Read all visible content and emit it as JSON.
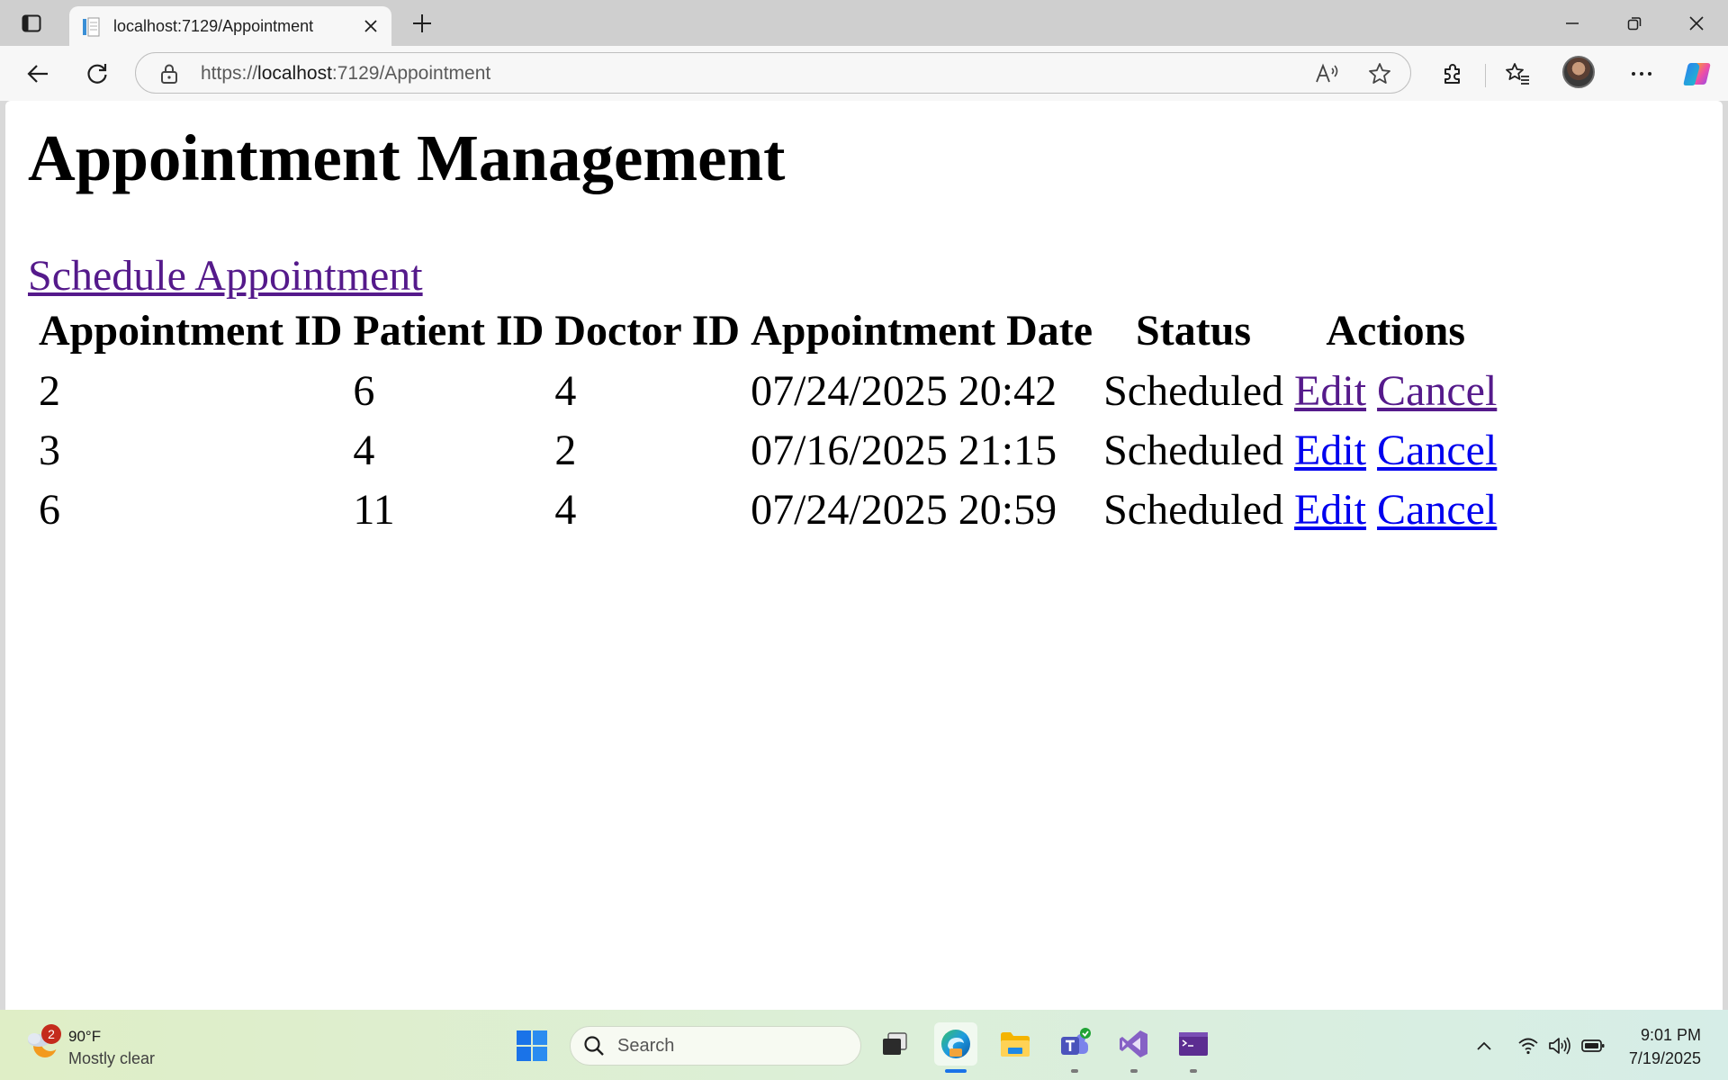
{
  "browser": {
    "tab": {
      "title": "localhost:7129/Appointment",
      "close_icon": "close-icon",
      "favicon": "page-icon"
    },
    "new_tab_icon": "plus-icon",
    "window_controls": [
      "minimize-icon",
      "restore-icon",
      "close-icon"
    ],
    "address": {
      "scheme": "https://",
      "host": "localhost",
      "rest": ":7129/Appointment"
    },
    "toolbar_icons": [
      "back-icon",
      "refresh-icon",
      "lock-icon",
      "read-aloud-icon",
      "favorite-star-icon",
      "extensions-icon",
      "favorites-icon",
      "profile-avatar",
      "more-icon",
      "copilot-icon"
    ]
  },
  "page": {
    "heading": "Appointment Management",
    "schedule_link": "Schedule Appointment",
    "table": {
      "headers": {
        "id": "Appointment ID",
        "patient": "Patient ID",
        "doctor": "Doctor ID",
        "date": "Appointment Date",
        "status": "Status",
        "actions": "Actions"
      },
      "rows": [
        {
          "id": "2",
          "patient": "6",
          "doctor": "4",
          "date": "07/24/2025 20:42",
          "status": "Scheduled",
          "edit": "Edit",
          "cancel": "Cancel"
        },
        {
          "id": "3",
          "patient": "4",
          "doctor": "2",
          "date": "07/16/2025 21:15",
          "status": "Scheduled",
          "edit": "Edit",
          "cancel": "Cancel"
        },
        {
          "id": "6",
          "patient": "11",
          "doctor": "4",
          "date": "07/24/2025 20:59",
          "status": "Scheduled",
          "edit": "Edit",
          "cancel": "Cancel"
        }
      ]
    },
    "link_colors": {
      "visited": "#551a8b",
      "unvisited": "#0000ee"
    }
  },
  "taskbar": {
    "weather": {
      "badge": "2",
      "temp": "90°F",
      "condition": "Mostly clear"
    },
    "search_placeholder": "Search",
    "apps": [
      "task-view-icon",
      "edge-icon",
      "file-explorer-icon",
      "teams-icon",
      "visual-studio-icon",
      "terminal-icon"
    ],
    "tray": [
      "chevron-up-icon",
      "wifi-icon",
      "volume-icon",
      "battery-icon"
    ],
    "clock": {
      "time": "9:01 PM",
      "date": "7/19/2025"
    }
  }
}
